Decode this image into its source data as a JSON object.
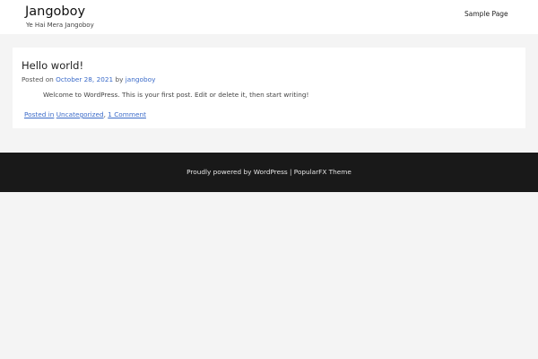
{
  "site": {
    "title": "Jangoboy",
    "tagline": "Ye Hai Mera Jangoboy"
  },
  "nav": {
    "items": [
      {
        "label": "Sample Page"
      }
    ]
  },
  "post": {
    "title": "Hello world!",
    "meta": {
      "posted_on_label": "Posted on",
      "date": "October 28, 2021",
      "by_label": "by",
      "author": "jangoboy"
    },
    "content": "Welcome to WordPress. This is your first post. Edit or delete it, then start writing!",
    "footer": {
      "posted_in_label": "Posted in",
      "category": "Uncategorized",
      "separator": ",",
      "comments": "1 Comment"
    }
  },
  "footer": {
    "credit": "Proudly powered by WordPress | PopularFX Theme"
  },
  "colors": {
    "link": "#3b6bc9",
    "footer_bg": "#191919",
    "page_bg": "#f4f4f4"
  }
}
